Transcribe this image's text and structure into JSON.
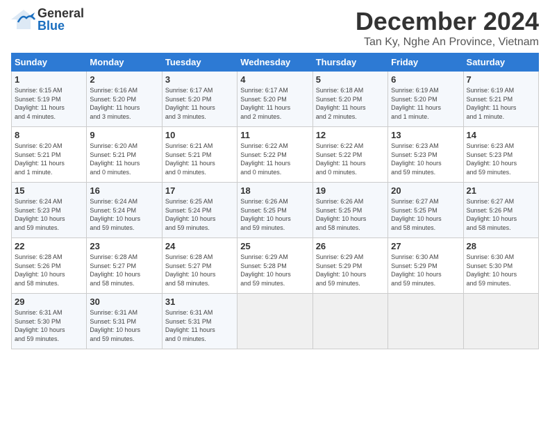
{
  "header": {
    "logo_general": "General",
    "logo_blue": "Blue",
    "title": "December 2024",
    "subtitle": "Tan Ky, Nghe An Province, Vietnam"
  },
  "weekdays": [
    "Sunday",
    "Monday",
    "Tuesday",
    "Wednesday",
    "Thursday",
    "Friday",
    "Saturday"
  ],
  "weeks": [
    [
      {
        "day": "1",
        "info": "Sunrise: 6:15 AM\nSunset: 5:19 PM\nDaylight: 11 hours\nand 4 minutes."
      },
      {
        "day": "2",
        "info": "Sunrise: 6:16 AM\nSunset: 5:20 PM\nDaylight: 11 hours\nand 3 minutes."
      },
      {
        "day": "3",
        "info": "Sunrise: 6:17 AM\nSunset: 5:20 PM\nDaylight: 11 hours\nand 3 minutes."
      },
      {
        "day": "4",
        "info": "Sunrise: 6:17 AM\nSunset: 5:20 PM\nDaylight: 11 hours\nand 2 minutes."
      },
      {
        "day": "5",
        "info": "Sunrise: 6:18 AM\nSunset: 5:20 PM\nDaylight: 11 hours\nand 2 minutes."
      },
      {
        "day": "6",
        "info": "Sunrise: 6:19 AM\nSunset: 5:20 PM\nDaylight: 11 hours\nand 1 minute."
      },
      {
        "day": "7",
        "info": "Sunrise: 6:19 AM\nSunset: 5:21 PM\nDaylight: 11 hours\nand 1 minute."
      }
    ],
    [
      {
        "day": "8",
        "info": "Sunrise: 6:20 AM\nSunset: 5:21 PM\nDaylight: 11 hours\nand 1 minute."
      },
      {
        "day": "9",
        "info": "Sunrise: 6:20 AM\nSunset: 5:21 PM\nDaylight: 11 hours\nand 0 minutes."
      },
      {
        "day": "10",
        "info": "Sunrise: 6:21 AM\nSunset: 5:21 PM\nDaylight: 11 hours\nand 0 minutes."
      },
      {
        "day": "11",
        "info": "Sunrise: 6:22 AM\nSunset: 5:22 PM\nDaylight: 11 hours\nand 0 minutes."
      },
      {
        "day": "12",
        "info": "Sunrise: 6:22 AM\nSunset: 5:22 PM\nDaylight: 11 hours\nand 0 minutes."
      },
      {
        "day": "13",
        "info": "Sunrise: 6:23 AM\nSunset: 5:23 PM\nDaylight: 10 hours\nand 59 minutes."
      },
      {
        "day": "14",
        "info": "Sunrise: 6:23 AM\nSunset: 5:23 PM\nDaylight: 10 hours\nand 59 minutes."
      }
    ],
    [
      {
        "day": "15",
        "info": "Sunrise: 6:24 AM\nSunset: 5:23 PM\nDaylight: 10 hours\nand 59 minutes."
      },
      {
        "day": "16",
        "info": "Sunrise: 6:24 AM\nSunset: 5:24 PM\nDaylight: 10 hours\nand 59 minutes."
      },
      {
        "day": "17",
        "info": "Sunrise: 6:25 AM\nSunset: 5:24 PM\nDaylight: 10 hours\nand 59 minutes."
      },
      {
        "day": "18",
        "info": "Sunrise: 6:26 AM\nSunset: 5:25 PM\nDaylight: 10 hours\nand 59 minutes."
      },
      {
        "day": "19",
        "info": "Sunrise: 6:26 AM\nSunset: 5:25 PM\nDaylight: 10 hours\nand 58 minutes."
      },
      {
        "day": "20",
        "info": "Sunrise: 6:27 AM\nSunset: 5:25 PM\nDaylight: 10 hours\nand 58 minutes."
      },
      {
        "day": "21",
        "info": "Sunrise: 6:27 AM\nSunset: 5:26 PM\nDaylight: 10 hours\nand 58 minutes."
      }
    ],
    [
      {
        "day": "22",
        "info": "Sunrise: 6:28 AM\nSunset: 5:26 PM\nDaylight: 10 hours\nand 58 minutes."
      },
      {
        "day": "23",
        "info": "Sunrise: 6:28 AM\nSunset: 5:27 PM\nDaylight: 10 hours\nand 58 minutes."
      },
      {
        "day": "24",
        "info": "Sunrise: 6:28 AM\nSunset: 5:27 PM\nDaylight: 10 hours\nand 58 minutes."
      },
      {
        "day": "25",
        "info": "Sunrise: 6:29 AM\nSunset: 5:28 PM\nDaylight: 10 hours\nand 59 minutes."
      },
      {
        "day": "26",
        "info": "Sunrise: 6:29 AM\nSunset: 5:29 PM\nDaylight: 10 hours\nand 59 minutes."
      },
      {
        "day": "27",
        "info": "Sunrise: 6:30 AM\nSunset: 5:29 PM\nDaylight: 10 hours\nand 59 minutes."
      },
      {
        "day": "28",
        "info": "Sunrise: 6:30 AM\nSunset: 5:30 PM\nDaylight: 10 hours\nand 59 minutes."
      }
    ],
    [
      {
        "day": "29",
        "info": "Sunrise: 6:31 AM\nSunset: 5:30 PM\nDaylight: 10 hours\nand 59 minutes."
      },
      {
        "day": "30",
        "info": "Sunrise: 6:31 AM\nSunset: 5:31 PM\nDaylight: 10 hours\nand 59 minutes."
      },
      {
        "day": "31",
        "info": "Sunrise: 6:31 AM\nSunset: 5:31 PM\nDaylight: 11 hours\nand 0 minutes."
      },
      {
        "day": "",
        "info": ""
      },
      {
        "day": "",
        "info": ""
      },
      {
        "day": "",
        "info": ""
      },
      {
        "day": "",
        "info": ""
      }
    ]
  ]
}
